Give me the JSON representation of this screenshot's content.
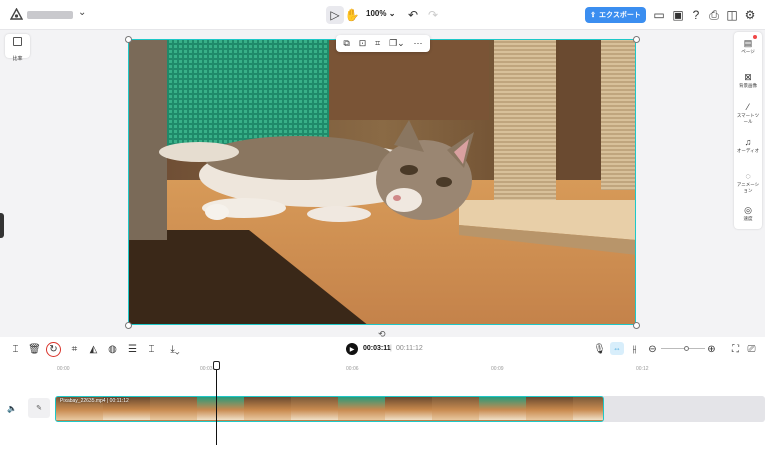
{
  "header": {
    "zoom_label": "100%",
    "export_label": "エクスポート"
  },
  "left": {
    "ratio_label": "比率"
  },
  "right_panel": {
    "items": [
      {
        "icon": "page-icon",
        "label": "ページ"
      },
      {
        "icon": "background-icon",
        "label": "背景画像"
      },
      {
        "icon": "magic-wand-icon",
        "label": "スマートツール"
      },
      {
        "icon": "music-icon",
        "label": "オーディオ"
      },
      {
        "icon": "animation-icon",
        "label": "アニメーション"
      },
      {
        "icon": "speed-icon",
        "label": "速度"
      }
    ]
  },
  "playback": {
    "current_time": "00:03:11",
    "separator": "|",
    "total_time": "00:11:12"
  },
  "ruler": [
    "00:00",
    "00:03",
    "00:06",
    "00:09",
    "00:12"
  ],
  "clip": {
    "label": "Pixabay_22635.mp4 | 00:11:12"
  },
  "colors": {
    "accent": "#3b8ef0",
    "selection": "#1ec8c8",
    "highlight_circle": "#d9342b"
  }
}
